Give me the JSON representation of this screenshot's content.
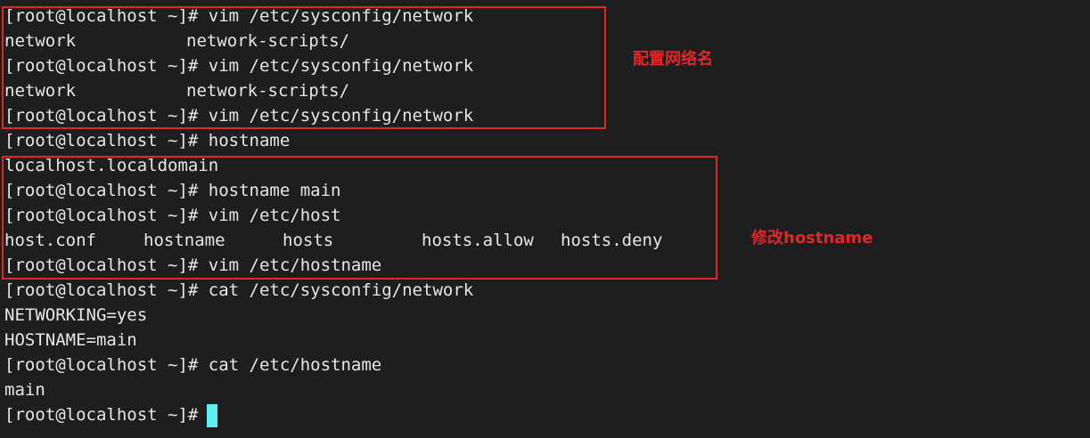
{
  "prompt": "[root@localhost ~]#",
  "lines": {
    "l1": " vim /etc/sysconfig/network",
    "l2": {
      "a": "network",
      "b": "network-scripts/"
    },
    "l3": " vim /etc/sysconfig/network",
    "l4": {
      "a": "network",
      "b": "network-scripts/"
    },
    "l5": " vim /etc/sysconfig/network",
    "l6": " hostname",
    "l7": "localhost.localdomain",
    "l8": " hostname main",
    "l9": " vim /etc/host",
    "l10": {
      "a": "host.conf",
      "b": "hostname",
      "c": "hosts",
      "d": "hosts.allow",
      "e": "hosts.deny"
    },
    "l11": " vim /etc/hostname",
    "l12": " cat /etc/sysconfig/network",
    "l13": "NETWORKING=yes",
    "l14": "HOSTNAME=main",
    "l15": " cat /etc/hostname",
    "l16": "main",
    "l17": ""
  },
  "annotations": {
    "network_name": "配置网络名",
    "modify_hostname": "修改hostname"
  },
  "colors": {
    "background": "#1e1e1e",
    "text": "#e6e6e6",
    "highlight": "#e0262b",
    "cursor": "#5ef0f0"
  }
}
